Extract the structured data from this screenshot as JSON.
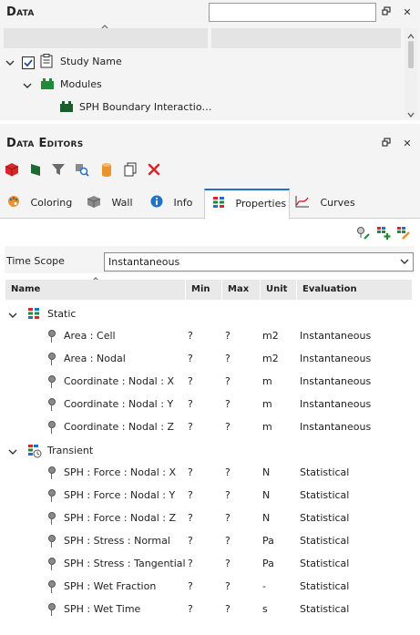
{
  "data_panel": {
    "title": "Data",
    "search_value": "",
    "tree": [
      {
        "label": "Study Name",
        "checked": true
      },
      {
        "label": "Modules"
      },
      {
        "label": "SPH Boundary Interactio…"
      }
    ]
  },
  "editors": {
    "title": "Data Editors",
    "tabs": [
      {
        "label": "Coloring"
      },
      {
        "label": "Wall"
      },
      {
        "label": "Info"
      },
      {
        "label": "Properties",
        "active": true
      },
      {
        "label": "Curves"
      }
    ],
    "time_scope_label": "Time Scope",
    "time_scope_value": "Instantaneous",
    "columns": {
      "name": "Name",
      "min": "Min",
      "max": "Max",
      "unit": "Unit",
      "evaluation": "Evaluation"
    },
    "groups": [
      {
        "label": "Static",
        "rows": [
          {
            "name": "Area : Cell",
            "min": "?",
            "max": "?",
            "unit": "m2",
            "evaluation": "Instantaneous"
          },
          {
            "name": "Area : Nodal",
            "min": "?",
            "max": "?",
            "unit": "m2",
            "evaluation": "Instantaneous"
          },
          {
            "name": "Coordinate : Nodal : X",
            "min": "?",
            "max": "?",
            "unit": "m",
            "evaluation": "Instantaneous"
          },
          {
            "name": "Coordinate : Nodal : Y",
            "min": "?",
            "max": "?",
            "unit": "m",
            "evaluation": "Instantaneous"
          },
          {
            "name": "Coordinate : Nodal : Z",
            "min": "?",
            "max": "?",
            "unit": "m",
            "evaluation": "Instantaneous"
          }
        ]
      },
      {
        "label": "Transient",
        "rows": [
          {
            "name": "SPH : Force : Nodal : X",
            "min": "?",
            "max": "?",
            "unit": "N",
            "evaluation": "Statistical"
          },
          {
            "name": "SPH : Force : Nodal : Y",
            "min": "?",
            "max": "?",
            "unit": "N",
            "evaluation": "Statistical"
          },
          {
            "name": "SPH : Force : Nodal : Z",
            "min": "?",
            "max": "?",
            "unit": "N",
            "evaluation": "Statistical"
          },
          {
            "name": "SPH : Stress : Normal",
            "min": "?",
            "max": "?",
            "unit": "Pa",
            "evaluation": "Statistical"
          },
          {
            "name": "SPH : Stress : Tangential",
            "min": "?",
            "max": "?",
            "unit": "Pa",
            "evaluation": "Statistical"
          },
          {
            "name": "SPH : Wet Fraction",
            "min": "?",
            "max": "?",
            "unit": "-",
            "evaluation": "Statistical"
          },
          {
            "name": "SPH : Wet Time",
            "min": "?",
            "max": "?",
            "unit": "s",
            "evaluation": "Statistical"
          }
        ]
      }
    ]
  },
  "icons": {
    "float": "float-window-icon",
    "close": "close-icon",
    "checkbox_checked": "checkbox-checked-icon"
  },
  "colors": {
    "accent_blue": "#1e72c7",
    "green_module": "#1f8a3a",
    "red_delete": "#d9262c"
  }
}
